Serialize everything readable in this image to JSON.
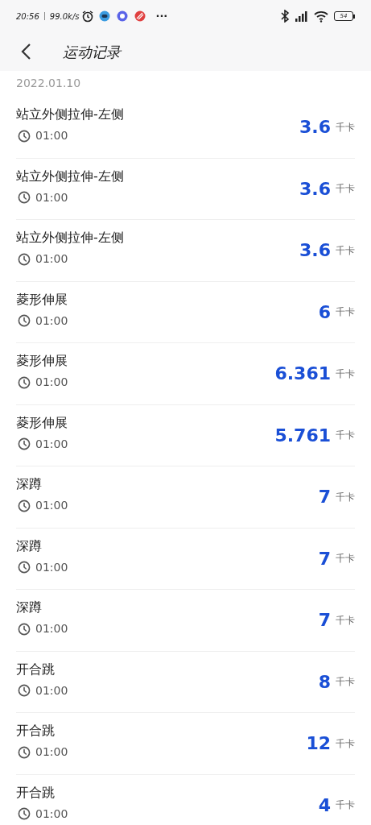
{
  "status_bar": {
    "time": "20:56",
    "speed": "99.0k/s",
    "more": "···",
    "battery": "54"
  },
  "header": {
    "title": "运动记录"
  },
  "date": "2022.01.10",
  "records": [
    {
      "name": "站立外侧拉伸-左侧",
      "duration": "01:00",
      "calories": "3.6",
      "unit": "千卡"
    },
    {
      "name": "站立外侧拉伸-左侧",
      "duration": "01:00",
      "calories": "3.6",
      "unit": "千卡"
    },
    {
      "name": "站立外侧拉伸-左侧",
      "duration": "01:00",
      "calories": "3.6",
      "unit": "千卡"
    },
    {
      "name": "菱形伸展",
      "duration": "01:00",
      "calories": "6",
      "unit": "千卡"
    },
    {
      "name": "菱形伸展",
      "duration": "01:00",
      "calories": "6.361",
      "unit": "千卡"
    },
    {
      "name": "菱形伸展",
      "duration": "01:00",
      "calories": "5.761",
      "unit": "千卡"
    },
    {
      "name": "深蹲",
      "duration": "01:00",
      "calories": "7",
      "unit": "千卡"
    },
    {
      "name": "深蹲",
      "duration": "01:00",
      "calories": "7",
      "unit": "千卡"
    },
    {
      "name": "深蹲",
      "duration": "01:00",
      "calories": "7",
      "unit": "千卡"
    },
    {
      "name": "开合跳",
      "duration": "01:00",
      "calories": "8",
      "unit": "千卡"
    },
    {
      "name": "开合跳",
      "duration": "01:00",
      "calories": "12",
      "unit": "千卡"
    },
    {
      "name": "开合跳",
      "duration": "01:00",
      "calories": "4",
      "unit": "千卡"
    }
  ]
}
